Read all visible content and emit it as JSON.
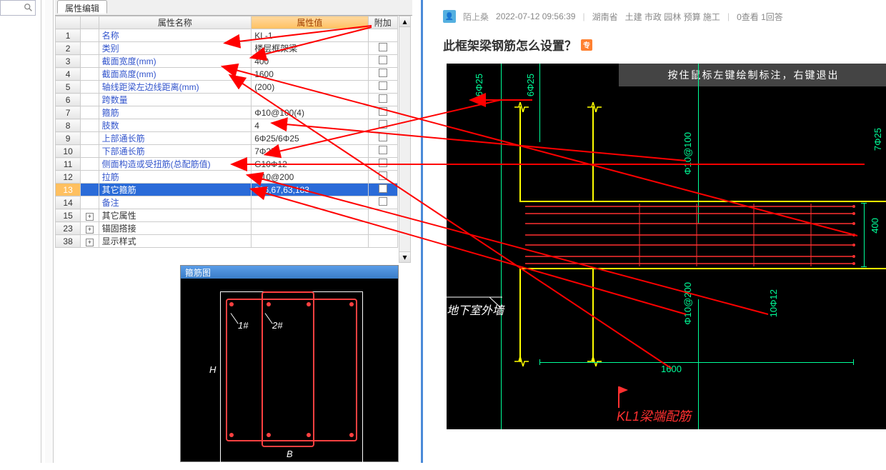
{
  "tab": {
    "label": "属性编辑"
  },
  "grid": {
    "headers": {
      "name": "属性名称",
      "value": "属性值",
      "add": "附加"
    },
    "rows": [
      {
        "n": "1",
        "name": "名称",
        "val": "KL-1",
        "link": true,
        "chk": false
      },
      {
        "n": "2",
        "name": "类别",
        "val": "楼层框架梁",
        "link": true,
        "chk": true
      },
      {
        "n": "3",
        "name": "截面宽度(mm)",
        "val": "400",
        "link": true,
        "chk": true
      },
      {
        "n": "4",
        "name": "截面高度(mm)",
        "val": "1600",
        "link": true,
        "chk": true
      },
      {
        "n": "5",
        "name": "轴线距梁左边线距离(mm)",
        "val": "(200)",
        "link": true,
        "chk": true
      },
      {
        "n": "6",
        "name": "跨数量",
        "val": "",
        "link": true,
        "chk": true
      },
      {
        "n": "7",
        "name": "箍筋",
        "val": "Φ10@100(4)",
        "link": true,
        "chk": true
      },
      {
        "n": "8",
        "name": "肢数",
        "val": "4",
        "link": true,
        "chk": true
      },
      {
        "n": "9",
        "name": "上部通长筋",
        "val": "6Φ25/6Φ25",
        "link": true,
        "chk": true
      },
      {
        "n": "10",
        "name": "下部通长筋",
        "val": "7Φ25",
        "link": true,
        "chk": true
      },
      {
        "n": "11",
        "name": "侧面构造或受扭筋(总配筋值)",
        "val": "G10Φ12",
        "link": true,
        "chk": true
      },
      {
        "n": "12",
        "name": "拉筋",
        "val": "Φ10@200",
        "link": true,
        "chk": true
      },
      {
        "n": "13",
        "name": "其它箍筋",
        "val": "396,67,63,183",
        "link": true,
        "chk": true,
        "sel": true
      },
      {
        "n": "14",
        "name": "备注",
        "val": "",
        "link": true,
        "chk": true
      },
      {
        "n": "15",
        "name": "其它属性",
        "val": "",
        "link": false,
        "exp": "+"
      },
      {
        "n": "23",
        "name": "锚固搭接",
        "val": "",
        "link": false,
        "exp": "+"
      },
      {
        "n": "38",
        "name": "显示样式",
        "val": "",
        "link": false,
        "exp": "+"
      }
    ]
  },
  "section": {
    "title": "箍筋图",
    "label1": "1#",
    "label2": "2#",
    "h": "H",
    "b": "B"
  },
  "post": {
    "user": "陌上桑",
    "time": "2022-07-12 09:56:39",
    "loc": "湖南省",
    "tags": "土建 市政 园林 预算 施工",
    "stats": "0查看 1回答",
    "title": "此框架梁钢筋怎么设置？",
    "badge": "专"
  },
  "cad": {
    "hint": "按住鼠标左键绘制标注，右键退出",
    "dim_w": "1600",
    "dim_h": "400",
    "wall": "地下室外墙",
    "kl": "KL1梁端配筋",
    "t1": "6Φ25",
    "t2": "6Φ25",
    "t3": "7Φ25",
    "t4": "Φ10@100",
    "t5": "Φ10@200",
    "t6": "10Φ12"
  }
}
